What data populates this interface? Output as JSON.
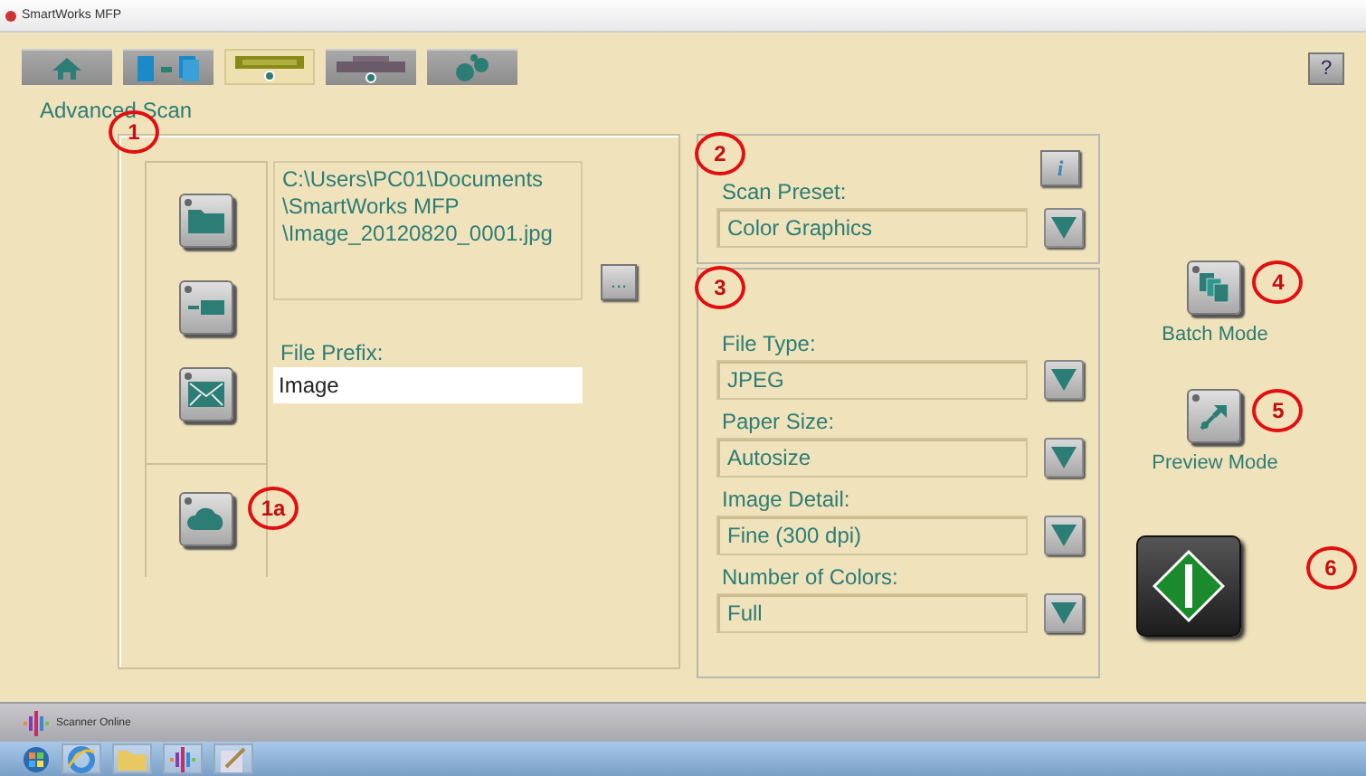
{
  "window": {
    "title": "SmartWorks MFP"
  },
  "tabs": [
    {
      "kind": "home",
      "selected": false
    },
    {
      "kind": "copy",
      "selected": false
    },
    {
      "kind": "scan",
      "selected": true
    },
    {
      "kind": "print",
      "selected": false
    },
    {
      "kind": "tools",
      "selected": false
    }
  ],
  "help_button": "?",
  "page_title": "Advanced Scan",
  "destination_panel": {
    "marker": "1",
    "destinations": [
      {
        "kind": "folder"
      },
      {
        "kind": "usb"
      },
      {
        "kind": "email"
      },
      {
        "kind": "cloud",
        "marker": "1a"
      }
    ],
    "file_path": [
      "C:\\Users\\PC01\\Documents",
      "\\SmartWorks MFP",
      "\\Image_20120820_0001.jpg"
    ],
    "browse_button": "...",
    "file_prefix": {
      "label": "File Prefix:",
      "value": "Image"
    }
  },
  "preset_panel": {
    "marker": "2",
    "info_button": "i",
    "label": "Scan Preset:",
    "value": "Color Graphics"
  },
  "settings_panel": {
    "marker": "3",
    "settings": [
      {
        "label": "File Type:",
        "value": "JPEG"
      },
      {
        "label": "Paper Size:",
        "value": "Autosize"
      },
      {
        "label": "Image Detail:",
        "value": "Fine (300 dpi)"
      },
      {
        "label": "Number of Colors:",
        "value": "Full"
      }
    ]
  },
  "mode_buttons": [
    {
      "kind": "batch",
      "label": "Batch Mode",
      "marker": "4"
    },
    {
      "kind": "preview",
      "label": "Preview Mode",
      "marker": "5"
    }
  ],
  "start_button": {
    "marker": "6"
  },
  "status_bar": "Scanner Online",
  "taskbar": [
    {
      "kind": "start"
    },
    {
      "kind": "browser"
    },
    {
      "kind": "folder"
    },
    {
      "kind": "app"
    },
    {
      "kind": "tool"
    }
  ]
}
